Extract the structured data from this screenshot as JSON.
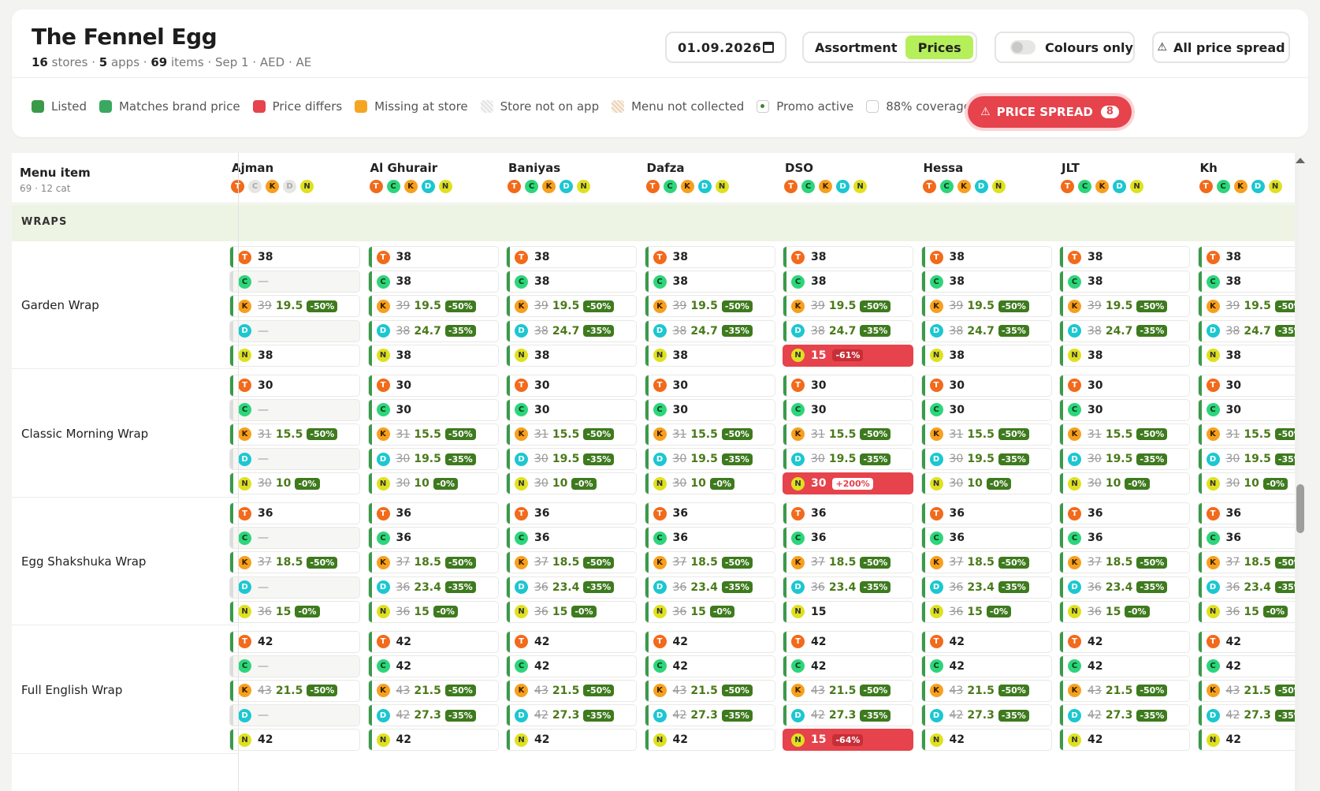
{
  "header": {
    "title": "The Fennel Egg",
    "stores": "16",
    "stores_label": "stores",
    "apps": "5",
    "apps_label": "apps",
    "items": "69",
    "items_label": "items",
    "meta": "· Sep 1 · AED · AE",
    "date": "01.09.2026",
    "tab_assortment": "Assortment",
    "tab_prices": "Prices",
    "colours_only": "Colours only",
    "all_price_spread": "All price spread"
  },
  "legend": {
    "listed": "Listed",
    "matches": "Matches brand price",
    "differs": "Price differs",
    "missing": "Missing at store",
    "not_on_app": "Store not on app",
    "not_collected": "Menu not collected",
    "promo": "Promo active",
    "coverage": "88% coverage"
  },
  "price_spread": {
    "label": "PRICE SPREAD",
    "count": "8"
  },
  "colors": {
    "listed": "#3a9a4a",
    "matches": "#3aa860",
    "differs": "#e6434c",
    "missing": "#f4a623",
    "accent": "#b5ef5a"
  },
  "table": {
    "menu_item": "Menu item",
    "menu_sub": "69 · 12 cat",
    "section": "WRAPS",
    "stores": [
      "Ajman",
      "Al Ghurair",
      "Baniyas",
      "Dafza",
      "DSO",
      "Hessa",
      "JLT",
      "Kh"
    ],
    "apps": [
      "T",
      "C",
      "K",
      "D",
      "N"
    ],
    "items": [
      {
        "name": "Garden Wrap"
      },
      {
        "name": "Classic Morning Wrap"
      },
      {
        "name": "Egg Shakshuka Wrap"
      },
      {
        "name": "Full English Wrap"
      }
    ]
  }
}
